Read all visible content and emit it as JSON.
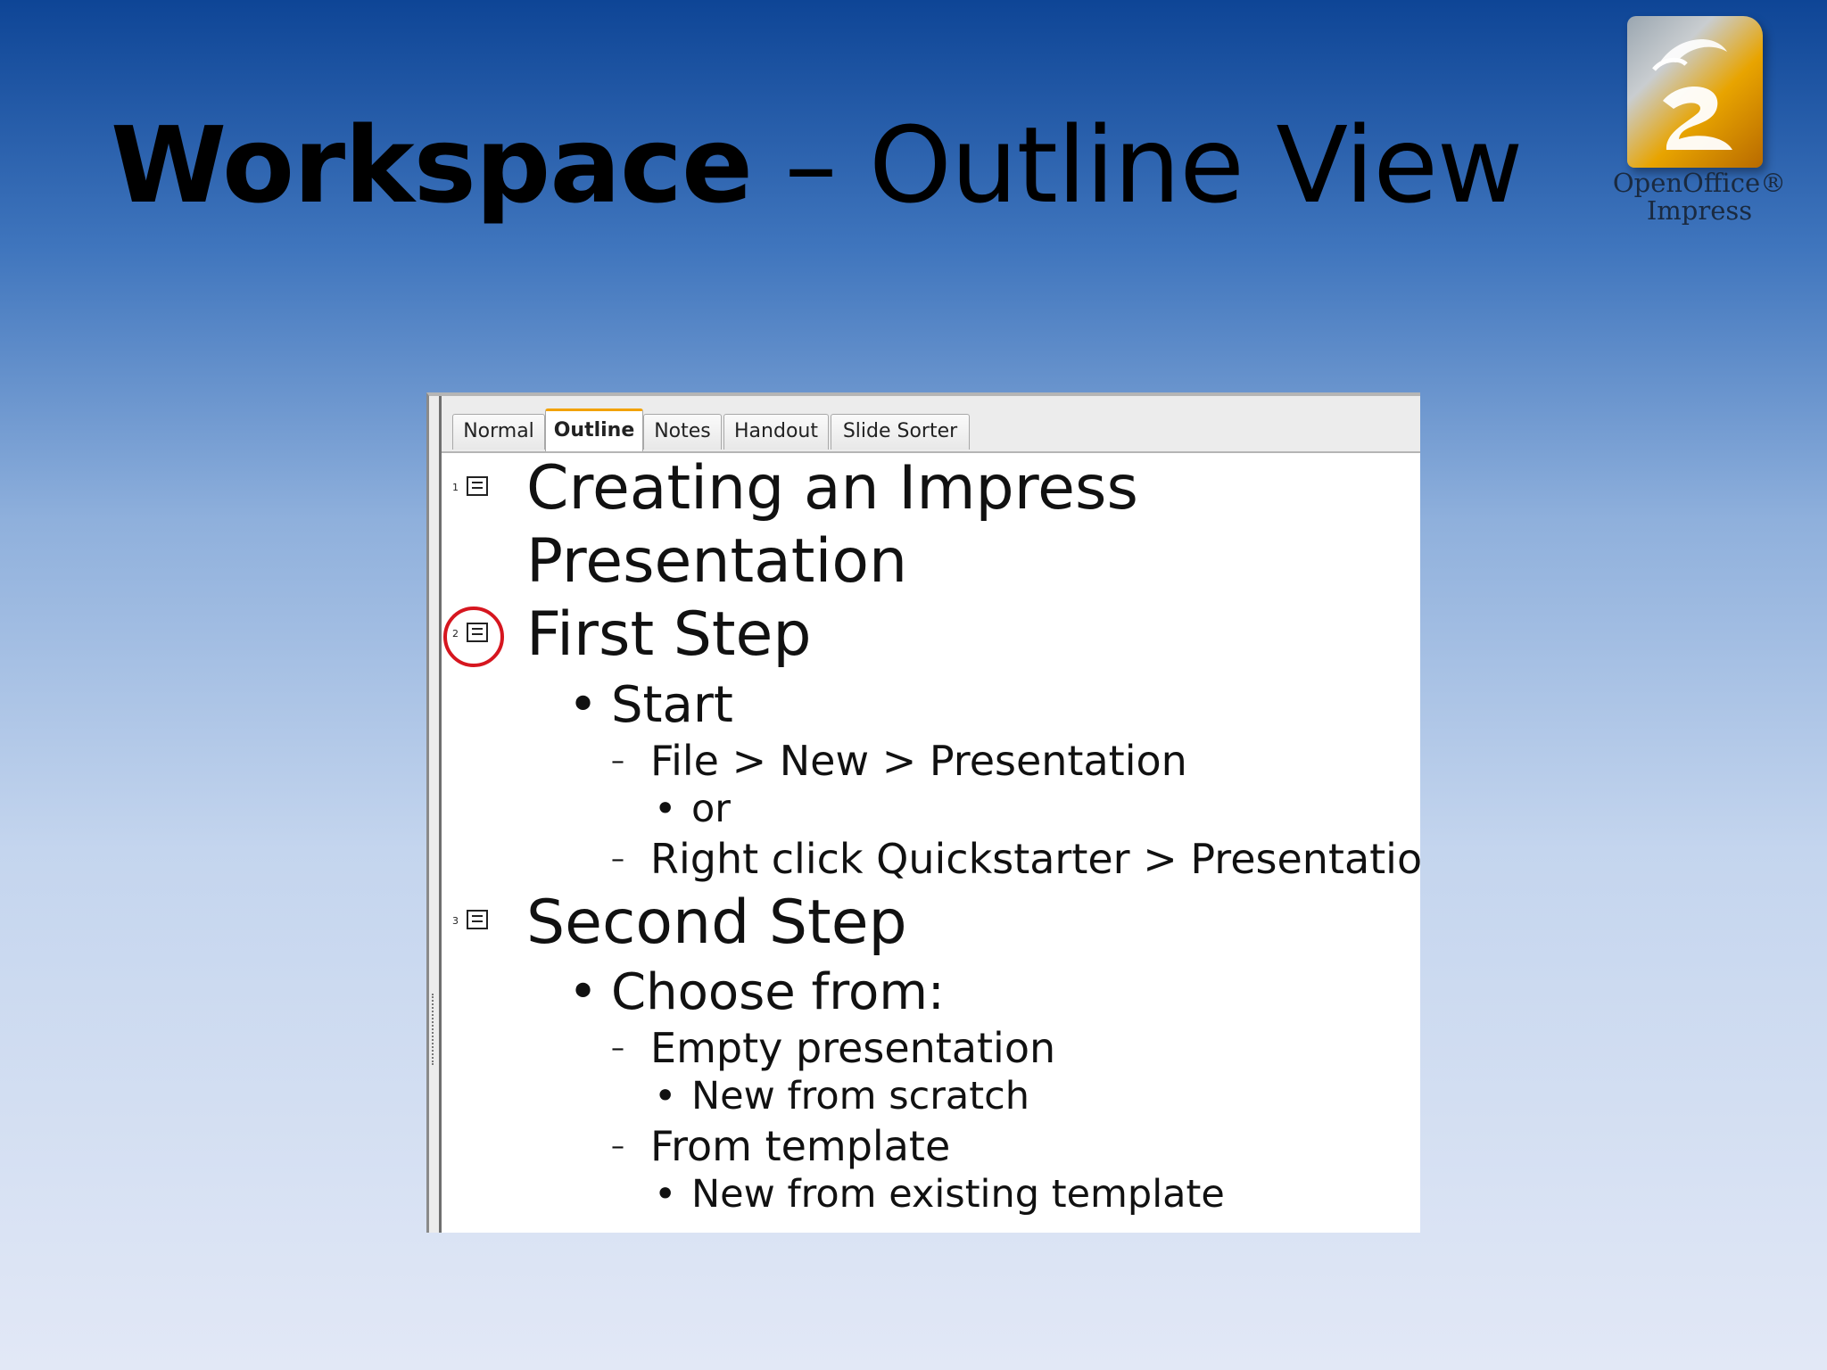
{
  "slide": {
    "title_strong": "Workspace",
    "title_rest": " – Outline View"
  },
  "logo": {
    "icon": "openoffice-impress-logo",
    "line1": "OpenOffice®",
    "line2": "Impress"
  },
  "tabs": [
    {
      "label": "Normal",
      "active": false
    },
    {
      "label": "Outline",
      "active": true
    },
    {
      "label": "Notes",
      "active": false
    },
    {
      "label": "Handout",
      "active": false
    },
    {
      "label": "Slide Sorter",
      "active": false
    }
  ],
  "outline": {
    "slides": [
      {
        "number": "1",
        "icon": "slide-icon",
        "title_line1": "Creating an Impress",
        "title_line2": "Presentation"
      },
      {
        "number": "2",
        "icon": "slide-icon",
        "title": "First Step",
        "highlighted": true
      },
      {
        "number": "3",
        "icon": "slide-icon",
        "title": "Second Step"
      }
    ],
    "items": {
      "start": "Start",
      "file_new": "File > New > Presentation",
      "or": "or",
      "right_click": "Right click Quickstarter > Presentation",
      "choose_from": "Choose from:",
      "empty_presentation": "Empty presentation",
      "new_from_scratch": "New from scratch",
      "from_template": "From template",
      "new_from_existing": "New from existing template"
    },
    "markers": {
      "bullet": "•",
      "dash": "–"
    }
  },
  "colors": {
    "highlight": "#d6161f",
    "active_tab_accent": "#f2a200"
  }
}
